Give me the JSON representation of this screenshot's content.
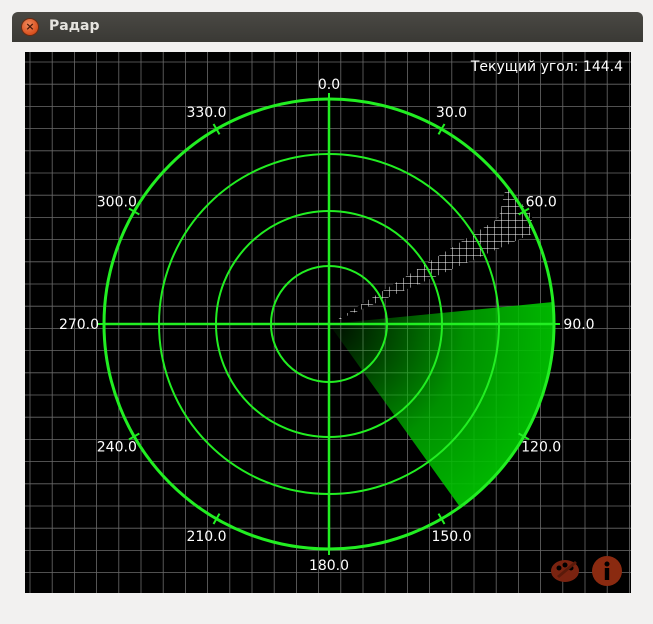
{
  "window": {
    "title": "Радар"
  },
  "status": {
    "current_angle": "Текущий угол: 144.4"
  },
  "radar": {
    "angle_labels": [
      "0.0",
      "30.0",
      "60.0",
      "90.0",
      "120.0",
      "150.0",
      "180.0",
      "210.0",
      "240.0",
      "270.0",
      "300.0",
      "330.0"
    ],
    "current_angle": 144.4,
    "colors": {
      "background": "#000000",
      "ring": "#22ee22",
      "grid": "#6a6a6a",
      "text": "#ffffff",
      "sweep": "#00c000",
      "target": "#ffffff",
      "icon": "#8a2a10"
    }
  },
  "toolbar": {
    "icons": [
      "palette-icon",
      "info-icon"
    ]
  }
}
